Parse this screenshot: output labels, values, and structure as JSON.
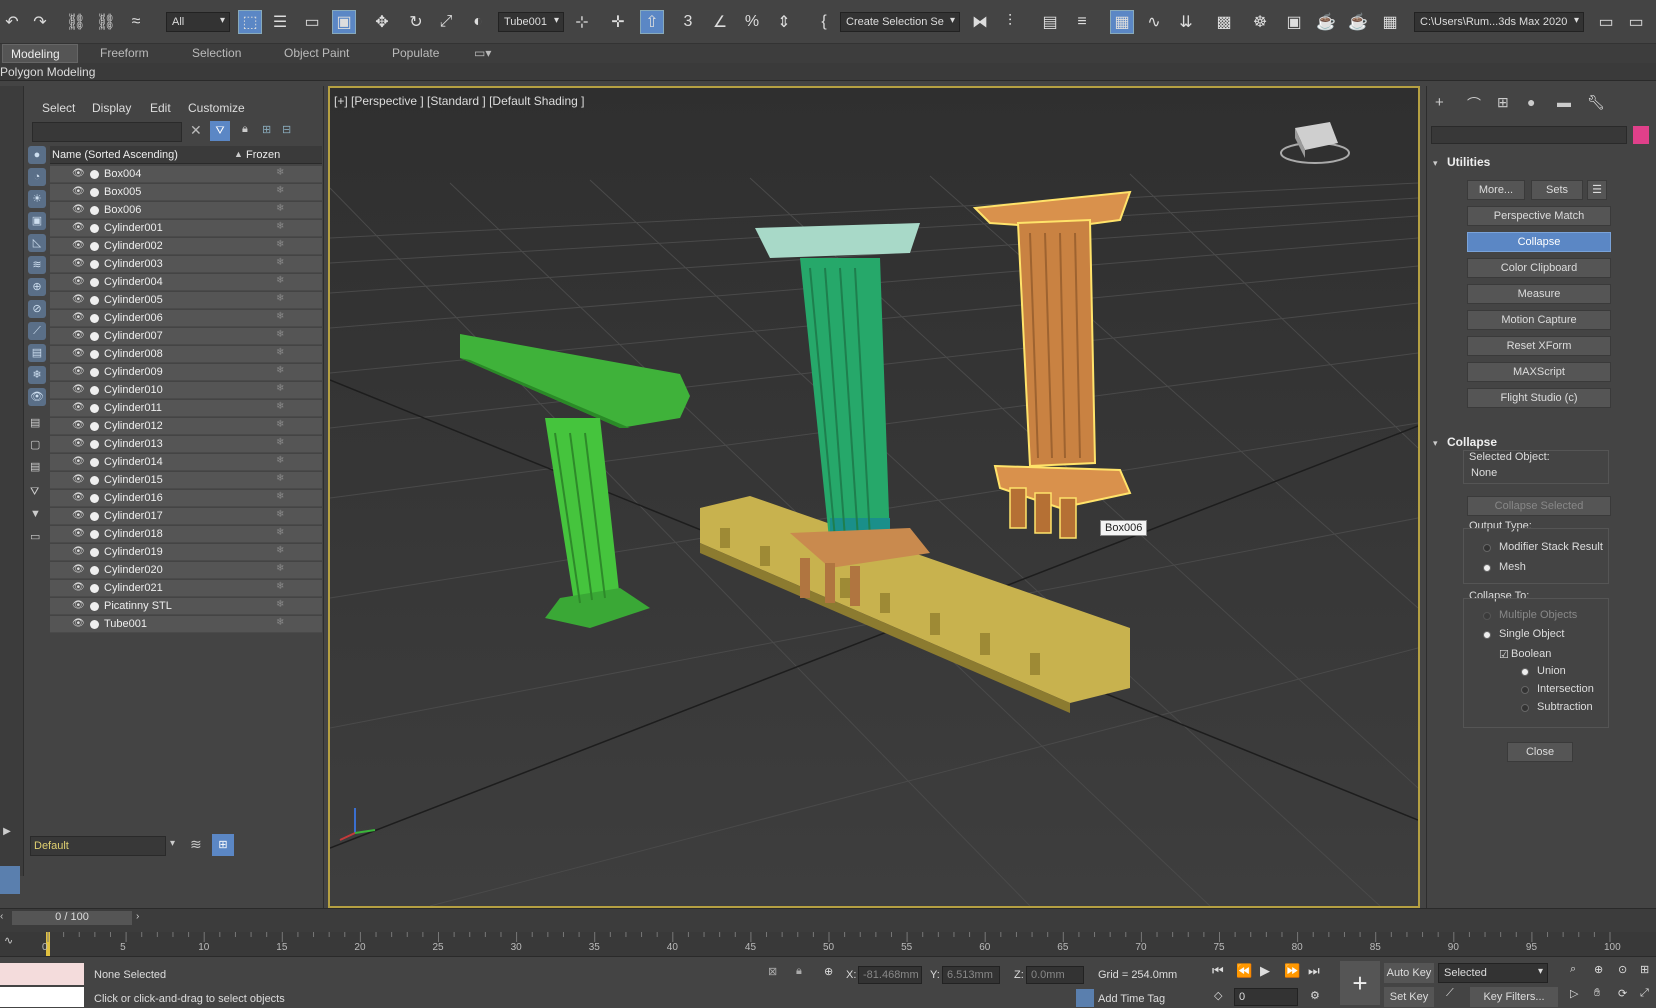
{
  "toolbar": {
    "filter_select": "All",
    "object_select": "Tube001",
    "named_sel": "Create Selection Se",
    "workspace_path": "C:\\Users\\Rum...3ds Max 2020"
  },
  "ribbon": {
    "tabs": [
      "Modeling",
      "Freeform",
      "Selection",
      "Object Paint",
      "Populate"
    ],
    "active_tab": "Modeling",
    "sub_label": "Polygon Modeling"
  },
  "scene_explorer": {
    "menu": [
      "Select",
      "Display",
      "Edit",
      "Customize"
    ],
    "col_name": "Name (Sorted Ascending)",
    "col_frozen": "Frozen",
    "sort_arrow": "▲",
    "rows": [
      "Box004",
      "Box005",
      "Box006",
      "Cylinder001",
      "Cylinder002",
      "Cylinder003",
      "Cylinder004",
      "Cylinder005",
      "Cylinder006",
      "Cylinder007",
      "Cylinder008",
      "Cylinder009",
      "Cylinder010",
      "Cylinder011",
      "Cylinder012",
      "Cylinder013",
      "Cylinder014",
      "Cylinder015",
      "Cylinder016",
      "Cylinder017",
      "Cylinder018",
      "Cylinder019",
      "Cylinder020",
      "Cylinder021",
      "Picatinny STL",
      "Tube001"
    ],
    "layer": "Default",
    "progress": "0 / 100"
  },
  "viewport": {
    "label": "[+] [Perspective ] [Standard ] [Default Shading ]",
    "tooltip": "Box006",
    "border_color": "#b5a042"
  },
  "command_panel": {
    "utilities_title": "Utilities",
    "more_btn": "More...",
    "sets_btn": "Sets",
    "utility_buttons": [
      "Perspective Match",
      "Collapse",
      "Color Clipboard",
      "Measure",
      "Motion Capture",
      "Reset XForm",
      "MAXScript",
      "Flight Studio (c)"
    ],
    "active_utility": "Collapse",
    "collapse_title": "Collapse",
    "selected_object_label": "Selected Object:",
    "selected_object_value": "None",
    "collapse_selected_btn": "Collapse Selected",
    "output_type_label": "Output Type:",
    "output_modifier": "Modifier Stack Result",
    "output_mesh": "Mesh",
    "collapse_to_label": "Collapse To:",
    "multiple_objects": "Multiple Objects",
    "single_object": "Single Object",
    "boolean": "Boolean",
    "union": "Union",
    "intersection": "Intersection",
    "subtraction": "Subtraction",
    "close_btn": "Close"
  },
  "timeline": {
    "ticks": [
      "0",
      "5",
      "10",
      "15",
      "20",
      "25",
      "30",
      "35",
      "40",
      "45",
      "50",
      "55",
      "60",
      "65",
      "70",
      "75",
      "80",
      "85",
      "90",
      "95",
      "100"
    ]
  },
  "status": {
    "selection": "None Selected",
    "prompt": "Click or click-and-drag to select objects",
    "x_label": "X:",
    "x_value": "-81.468mm",
    "y_label": "Y:",
    "y_value": "6.513mm",
    "z_label": "Z:",
    "z_value": "0.0mm",
    "grid": "Grid = 254.0mm",
    "add_time_tag": "Add Time Tag",
    "auto_key": "Auto Key",
    "set_key": "Set Key",
    "key_mode": "Selected",
    "key_filters": "Key Filters...",
    "frame": "0"
  }
}
